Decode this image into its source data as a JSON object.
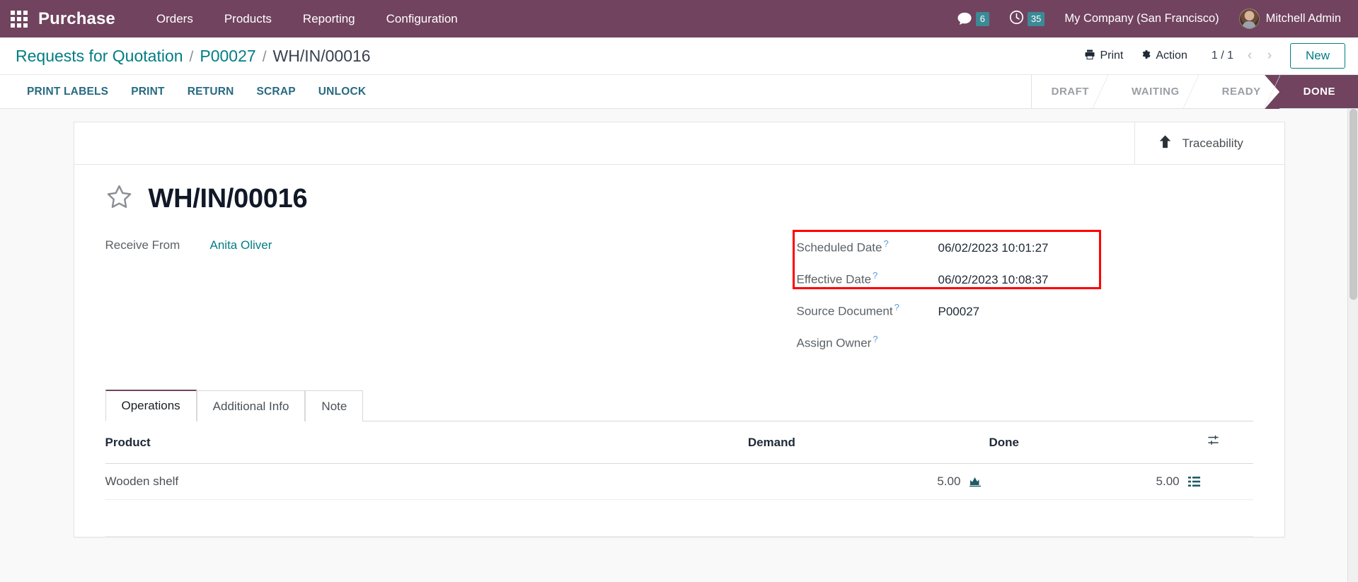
{
  "navbar": {
    "apps_icon": "apps-grid-icon",
    "brand": "Purchase",
    "menu": [
      {
        "label": "Orders"
      },
      {
        "label": "Products"
      },
      {
        "label": "Reporting"
      },
      {
        "label": "Configuration"
      }
    ],
    "messages": {
      "icon": "chat-bubble-icon",
      "count": "6"
    },
    "activities": {
      "icon": "clock-icon",
      "count": "35"
    },
    "company": "My Company (San Francisco)",
    "user": "Mitchell Admin",
    "accent_color": "#71435f",
    "badge_color": "#3b8a96"
  },
  "control_panel": {
    "breadcrumb": {
      "items": [
        {
          "label": "Requests for Quotation",
          "link": true
        },
        {
          "label": "P00027",
          "link": true
        },
        {
          "label": "WH/IN/00016",
          "link": false
        }
      ],
      "separator": "/"
    },
    "print_label": "Print",
    "print_icon": "printer-icon",
    "action_label": "Action",
    "action_icon": "gear-icon",
    "pager": {
      "value": "1 / 1",
      "prev_icon": "chevron-left-icon",
      "next_icon": "chevron-right-icon"
    },
    "new_label": "New"
  },
  "statusbar": {
    "buttons": [
      {
        "label": "PRINT LABELS"
      },
      {
        "label": "PRINT"
      },
      {
        "label": "RETURN"
      },
      {
        "label": "SCRAP"
      },
      {
        "label": "UNLOCK"
      }
    ],
    "stages": [
      {
        "label": "DRAFT",
        "active": false
      },
      {
        "label": "WAITING",
        "active": false
      },
      {
        "label": "READY",
        "active": false
      },
      {
        "label": "DONE",
        "active": true
      }
    ],
    "button_color": "#286a82",
    "active_stage_color": "#71435f"
  },
  "sheet": {
    "stat_buttons": [
      {
        "label": "Traceability",
        "icon": "up-arrow-icon"
      }
    ],
    "favorite_icon": "star-outline-icon",
    "title": "WH/IN/00016",
    "fields_left": [
      {
        "label": "Receive From",
        "value": "Anita Oliver",
        "is_link": true,
        "has_tip": false
      }
    ],
    "fields_right": [
      {
        "label": "Scheduled Date",
        "value": "06/02/2023 10:01:27",
        "has_tip": true,
        "highlighted": true
      },
      {
        "label": "Effective Date",
        "value": "06/02/2023 10:08:37",
        "has_tip": true,
        "highlighted": true
      },
      {
        "label": "Source Document",
        "value": "P00027",
        "has_tip": true,
        "highlighted": false
      },
      {
        "label": "Assign Owner",
        "value": "",
        "has_tip": true,
        "highlighted": false
      }
    ],
    "highlight_color": "#ff0000",
    "tabs": [
      {
        "label": "Operations",
        "active": true
      },
      {
        "label": "Additional Info",
        "active": false
      },
      {
        "label": "Note",
        "active": false
      }
    ],
    "table": {
      "columns": [
        {
          "label": "Product"
        },
        {
          "label": "Demand"
        },
        {
          "label": "Done"
        },
        {
          "label": "",
          "icon": "optional-columns-icon"
        }
      ],
      "rows": [
        {
          "product": "Wooden shelf",
          "demand": "5.00",
          "demand_icon": "forecast-report-icon",
          "done": "5.00",
          "done_icon": "detailed-operations-icon"
        }
      ]
    }
  }
}
